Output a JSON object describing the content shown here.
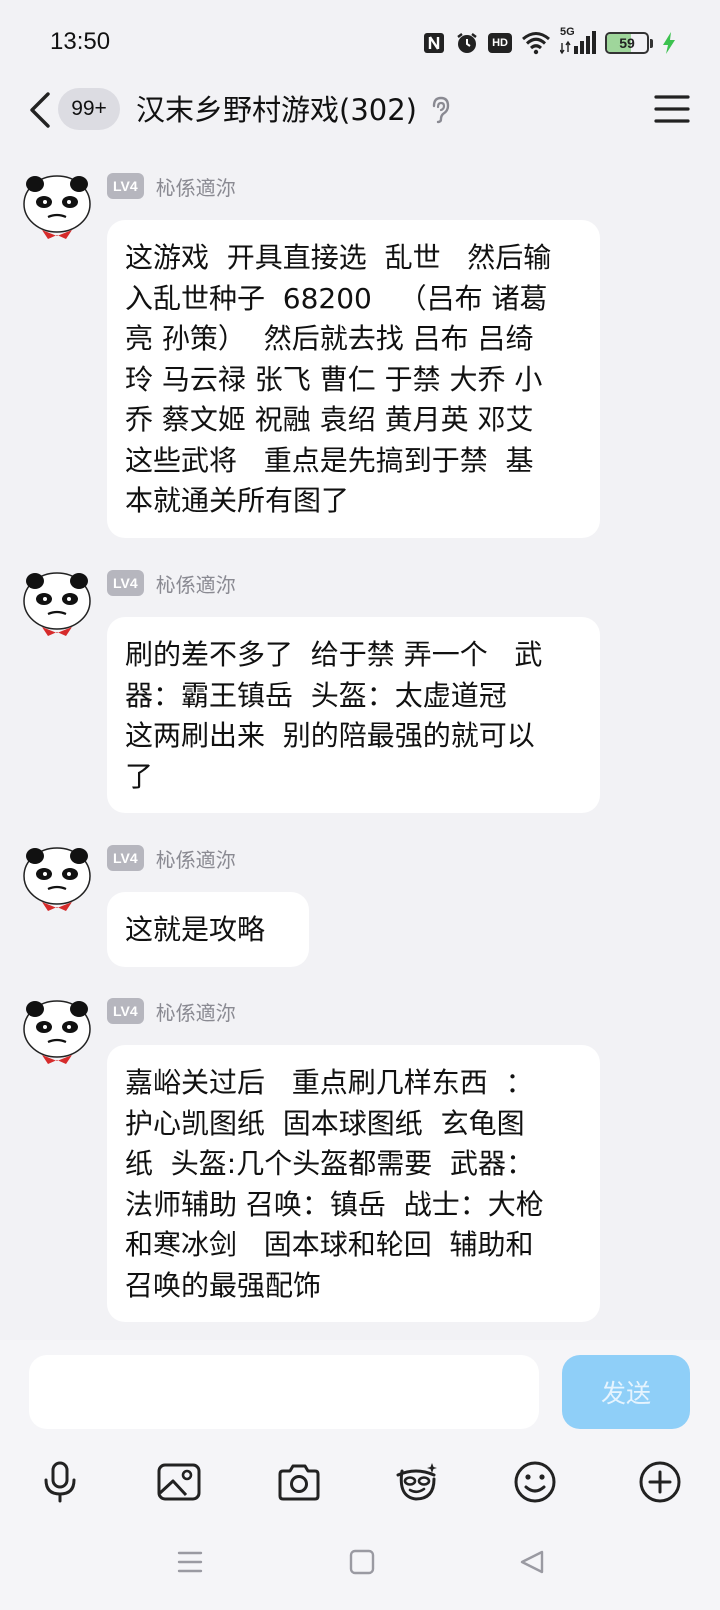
{
  "status_bar": {
    "time": "13:50",
    "network": "5G",
    "hd_label": "HD",
    "battery_level": 59,
    "battery_text": "59",
    "charging": true
  },
  "header": {
    "unread_badge": "99+",
    "title": "汉末乡野村游戏(302)"
  },
  "messages": [
    {
      "level": "LV4",
      "sender": "杺係適沵",
      "text": "这游戏  开具直接选  乱世   然后输\n入乱世种子  68200   （吕布 诸葛\n亮 孙策）  然后就去找 吕布 吕绮\n玲 马云禄 张飞 曹仁 于禁 大乔 小\n乔 蔡文姬 祝融 袁绍 黄月英 邓艾 \n这些武将   重点是先搞到于禁  基\n本就通关所有图了"
    },
    {
      "level": "LV4",
      "sender": "杺係適沵",
      "text": "刷的差不多了  给于禁 弄一个   武\n器：霸王镇岳  头盔：太虚道冠  \n这两刷出来  别的陪最强的就可以\n了"
    },
    {
      "level": "LV4",
      "sender": "杺係適沵",
      "text": "这就是攻略"
    },
    {
      "level": "LV4",
      "sender": "杺係適沵",
      "text": "嘉峪关过后   重点刷几样东西  ：\n护心凯图纸  固本球图纸  玄龟图\n纸  头盔:几个头盔都需要  武器：\n法师辅助 召唤：镇岳  战士：大枪\n和寒冰剑   固本球和轮回  辅助和\n召唤的最强配饰"
    }
  ],
  "composer": {
    "input_value": "",
    "send_label": "发送"
  },
  "colors": {
    "background": "#f2f2f5",
    "bubble": "#ffffff",
    "send_button": "#8fcff8",
    "level_badge": "#b6b6be",
    "charging": "#3cc24f"
  },
  "icons": {
    "back": "chevron-left-icon",
    "ear": "ear-icon",
    "menu": "hamburger-menu-icon",
    "toolbar": [
      "microphone-icon",
      "image-icon",
      "camera-icon",
      "sticker-icon",
      "emoji-icon",
      "plus-circle-icon"
    ],
    "nav": [
      "recent-apps-icon",
      "home-icon",
      "back-triangle-icon"
    ]
  }
}
